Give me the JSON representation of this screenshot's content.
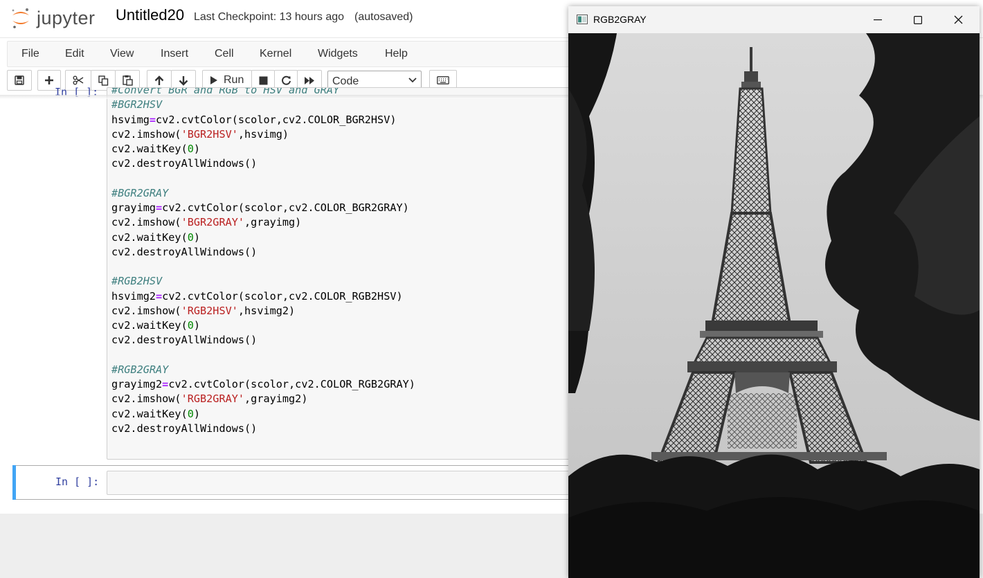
{
  "header": {
    "logo_text": "jupyter",
    "notebook_title": "Untitled20",
    "checkpoint": "Last Checkpoint: 13 hours ago",
    "autosave": "(autosaved)"
  },
  "menu": [
    "File",
    "Edit",
    "View",
    "Insert",
    "Cell",
    "Kernel",
    "Widgets",
    "Help"
  ],
  "toolbar": {
    "run_label": "Run",
    "cell_type": "Code",
    "icons": [
      "save-icon",
      "plus-icon",
      "cut-icon",
      "copy-icon",
      "paste-icon",
      "arrow-up-icon",
      "arrow-down-icon",
      "play-icon",
      "stop-icon",
      "restart-icon",
      "fast-forward-icon",
      "keyboard-icon"
    ]
  },
  "cells": [
    {
      "prompt": "In [ ]:",
      "lines": [
        "#Convert BGR and RGB to HSV and GRAY",
        "#BGR2HSV",
        "hsvimg=cv2.cvtColor(scolor,cv2.COLOR_BGR2HSV)",
        "cv2.imshow('BGR2HSV',hsvimg)",
        "cv2.waitKey(0)",
        "cv2.destroyAllWindows()",
        "",
        "#BGR2GRAY",
        "grayimg=cv2.cvtColor(scolor,cv2.COLOR_BGR2GRAY)",
        "cv2.imshow('BGR2GRAY',grayimg)",
        "cv2.waitKey(0)",
        "cv2.destroyAllWindows()",
        "",
        "#RGB2HSV",
        "hsvimg2=cv2.cvtColor(scolor,cv2.COLOR_RGB2HSV)",
        "cv2.imshow('RGB2HSV',hsvimg2)",
        "cv2.waitKey(0)",
        "cv2.destroyAllWindows()",
        "",
        "#RGB2GRAY",
        "grayimg2=cv2.cvtColor(scolor,cv2.COLOR_RGB2GRAY)",
        "cv2.imshow('RGB2GRAY',grayimg2)",
        "cv2.waitKey(0)",
        "cv2.destroyAllWindows()"
      ]
    },
    {
      "prompt": "In [ ]:",
      "lines": []
    }
  ],
  "cv_window": {
    "title": "RGB2GRAY",
    "image_subject": "grayscale photo of the Eiffel Tower framed by trees",
    "controls": [
      "minimize-icon",
      "maximize-icon",
      "close-icon"
    ]
  },
  "colors": {
    "jupyter_orange": "#f37726",
    "prompt_blue": "#303f9f",
    "selected_cell_bar": "#42a5f5",
    "comment": "#408080",
    "string": "#ba2121",
    "number": "#008800",
    "operator": "#aa22ff"
  }
}
